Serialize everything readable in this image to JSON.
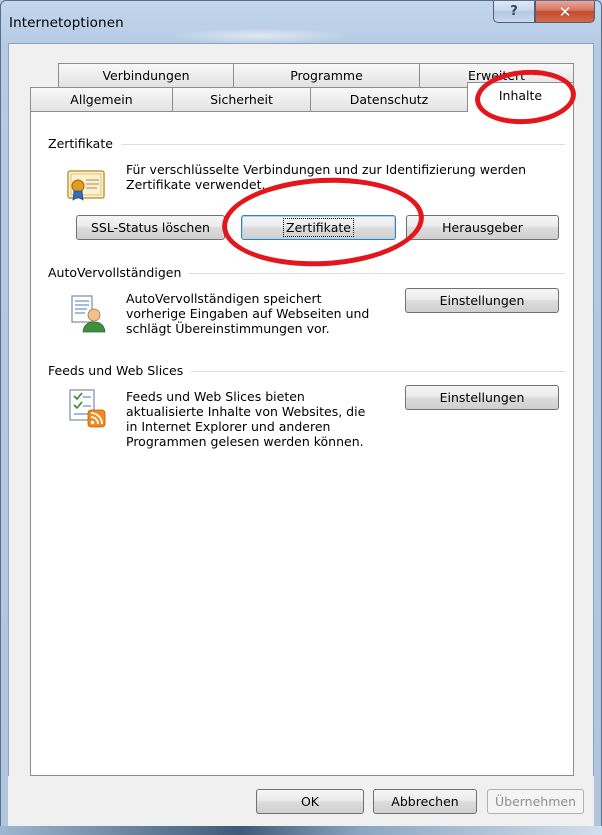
{
  "window": {
    "title": "Internetoptionen",
    "help_glyph": "?",
    "close_glyph": "✕"
  },
  "tabs": {
    "row_back": [
      {
        "label": "Verbindungen"
      },
      {
        "label": "Programme"
      },
      {
        "label": "Erweitert"
      }
    ],
    "row_front": [
      {
        "label": "Allgemein"
      },
      {
        "label": "Sicherheit"
      },
      {
        "label": "Datenschutz"
      },
      {
        "label": "Inhalte"
      }
    ],
    "active": "Inhalte"
  },
  "certificates": {
    "heading": "Zertifikate",
    "description_line1": "Für verschlüsselte Verbindungen und zur Identifizierung werden",
    "description_line2": "Zertifikate verwendet.",
    "icon": "certificate-icon",
    "buttons": {
      "ssl_clear": "SSL-Status löschen",
      "certificates": "Zertifikate",
      "publishers": "Herausgeber"
    }
  },
  "autocomplete": {
    "heading": "AutoVervollständigen",
    "description_line1": "AutoVervollständigen speichert",
    "description_line2": "vorherige Eingaben auf Webseiten und",
    "description_line3": "schlägt Übereinstimmungen vor.",
    "icon": "autocomplete-user-icon",
    "settings_button": "Einstellungen"
  },
  "feeds": {
    "heading": "Feeds und Web Slices",
    "description_line1": "Feeds und Web Slices bieten",
    "description_line2": "aktualisierte Inhalte von Websites, die",
    "description_line3": "in Internet Explorer und anderen",
    "description_line4": "Programmen gelesen werden können.",
    "icon": "feed-rss-icon",
    "settings_button": "Einstellungen"
  },
  "footer": {
    "ok": "OK",
    "cancel": "Abbrechen",
    "apply": "Übernehmen"
  },
  "colors": {
    "highlight_ring": "#e3161c",
    "title_bar": "#b5cbe3",
    "close_button": "#c24a31"
  }
}
